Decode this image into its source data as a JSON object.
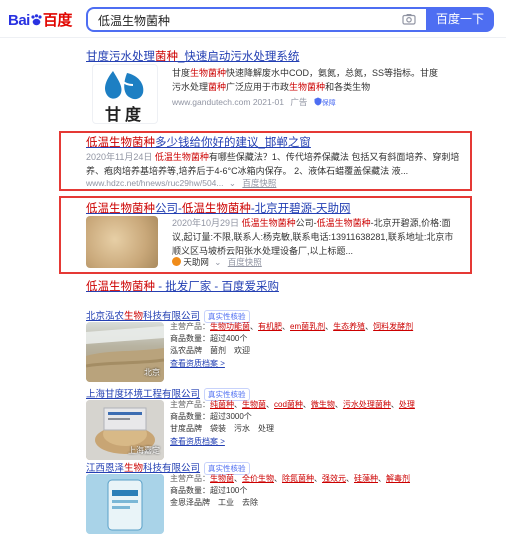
{
  "header": {
    "logo_text": "百度",
    "logo_prefix": "Bai",
    "search_value": "低温生物菌种",
    "search_button": "百度一下"
  },
  "results": {
    "r1": {
      "title_pre": "甘度污水处理",
      "title_hl": "菌种",
      "title_post": "_快速启动污水处理系统",
      "logo_text": "甘度",
      "desc_1": "甘度",
      "desc_1_hl": "生物菌种",
      "desc_1_post": "快速降解废水中COD，氨氮，总氮，SS等指标。甘度污水处理",
      "desc_2_hl": "菌种",
      "desc_2_post": "广泛应用于市政",
      "desc_2_hl2": "生物菌种",
      "desc_2_post2": "和各类生物",
      "url": "www.gandutech.com",
      "date": "2021-01",
      "ad": "广告",
      "badge": "保障"
    },
    "r2": {
      "title_hl": "低温生物菌种",
      "title_post": "多少钱给你好的建议_邯郸之窗",
      "date": "2020年11月24日",
      "desc_hl": "低温生物菌种",
      "desc_1": "有哪些保藏法？1、传代培养保藏法 包括又有斜面培养、穿刺培",
      "desc_2": "养、疱肉培养基培养等,培养后于4-6°C冰箱内保存。 2、液体石蜡覆盖保藏法 液...",
      "url": "www.hdzc.net/hnews/ruc29hw/504...",
      "snapshot": "百度快照"
    },
    "r3": {
      "title_hl": "低温生物菌种",
      "title_mid": "公司-",
      "title_hl2": "低温生物菌种",
      "title_post": "-北京开碧源-天助网",
      "date": "2020年10月29日",
      "desc_hl": "低温生物菌种",
      "desc_mid": "公司-",
      "desc_hl2": "低温生物菌种",
      "desc_1": "-北京开碧源,价格:面",
      "desc_2": "议,起订量:不限,联系人:杨克敏,联系电话:13911638281,联系地址:北京市",
      "desc_3": "顺义区马坡桥云阳张水处理设备厂,以上标题...",
      "source": "天助网",
      "snapshot": "百度快照"
    },
    "r4": {
      "title_hl": "低温生物菌种",
      "title_post": " - 批发厂家 - 百度爱采购"
    }
  },
  "cards": [
    {
      "name_pre": "北京泓农",
      "name_hl": "生物",
      "name_post": "科技有限公司",
      "badge": "真实性核验",
      "image_label": "北京",
      "products_label": "主营产品：",
      "products": [
        "生物功能菌",
        "有机肥",
        "em菌乳剂",
        "生态养殖",
        "饲料发酵剂"
      ],
      "count": "商品数量：超过400个",
      "brand": "泓农品牌　菌剂　欢迎",
      "link": "查看资质档案 >"
    },
    {
      "name_pre": "上海甘度环境工程有限公司",
      "name_hl": "",
      "name_post": "",
      "badge": "真实性核验",
      "image_label": "上海嘉定",
      "products_label": "主营产品：",
      "products": [
        "纯菌种",
        "生物菌",
        "cod菌种",
        "微生物",
        "污水处理菌种",
        "处理"
      ],
      "count": "商品数量：超过3000个",
      "brand": "甘度品牌　袋装　污水　处理",
      "link": "查看资质档案 >"
    },
    {
      "name_pre": "江西恩泽",
      "name_hl": "生物",
      "name_post": "科技有限公司",
      "badge": "真实性核验",
      "image_label": "",
      "products_label": "主营产品：",
      "products": [
        "生物菌",
        "全价生物",
        "除氮菌种",
        "强效元",
        "硅藻种",
        "解毒剂"
      ],
      "count": "商品数量：超过100个",
      "brand": "金恩泽品牌　工业　去除",
      "link": "查看资质档案 >"
    }
  ],
  "colors": {
    "accent": "#4e6ef2",
    "link": "#2440b3",
    "highlight": "#cc0000",
    "frame": "#e53935"
  }
}
